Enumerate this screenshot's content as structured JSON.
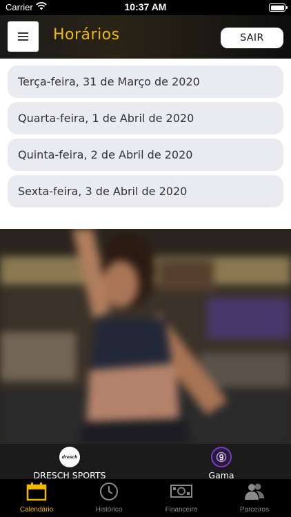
{
  "status_bar": {
    "carrier": "Carrier",
    "time": "10:37 AM"
  },
  "header": {
    "title": "Horários",
    "logout_label": "SAIR"
  },
  "dates": [
    "Terça-feira, 31 de Março de 2020",
    "Quarta-feira, 1 de Abril de 2020",
    "Quinta-feira, 2 de Abril de 2020",
    "Sexta-feira, 3 de Abril de 2020"
  ],
  "partners": [
    {
      "name": "DRESCH SPORTS",
      "logo_text": "dresch"
    },
    {
      "name": "Gama",
      "logo_text": "g"
    }
  ],
  "tabs": [
    {
      "label": "Calendário",
      "icon": "calendar-icon",
      "active": true
    },
    {
      "label": "Histórico",
      "icon": "clock-icon",
      "active": false
    },
    {
      "label": "Financeiro",
      "icon": "money-icon",
      "active": false
    },
    {
      "label": "Parceiros",
      "icon": "partners-icon",
      "active": false
    }
  ],
  "colors": {
    "accent": "#f0b900",
    "card": "#e9ebf1",
    "inactive_tab": "#8a8a8a"
  }
}
